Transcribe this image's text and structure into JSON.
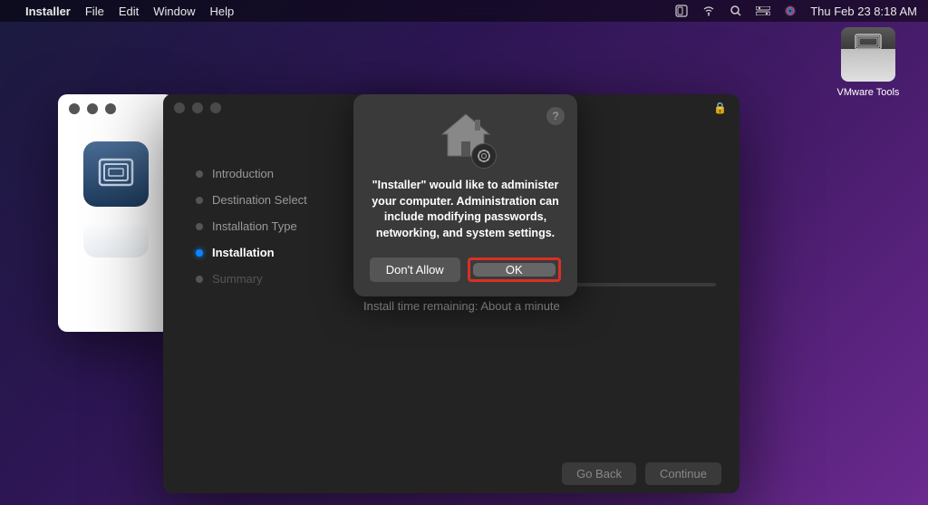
{
  "menubar": {
    "app_name": "Installer",
    "menus": [
      "File",
      "Edit",
      "Window",
      "Help"
    ],
    "clock": "Thu Feb 23  8:18 AM"
  },
  "desktop": {
    "icon_label": "VMware Tools"
  },
  "installer": {
    "sidebar": {
      "items": [
        {
          "label": "Introduction",
          "state": "done"
        },
        {
          "label": "Destination Select",
          "state": "done"
        },
        {
          "label": "Installation Type",
          "state": "done"
        },
        {
          "label": "Installation",
          "state": "active"
        },
        {
          "label": "Summary",
          "state": "pending"
        }
      ]
    },
    "progress": {
      "percent": 45,
      "label": "Install time remaining: About a minute"
    },
    "buttons": {
      "go_back": "Go Back",
      "continue": "Continue"
    }
  },
  "alert": {
    "message": "\"Installer\" would like to administer your computer. Administration can include modifying passwords, networking, and system settings.",
    "deny_label": "Don't Allow",
    "ok_label": "OK"
  }
}
